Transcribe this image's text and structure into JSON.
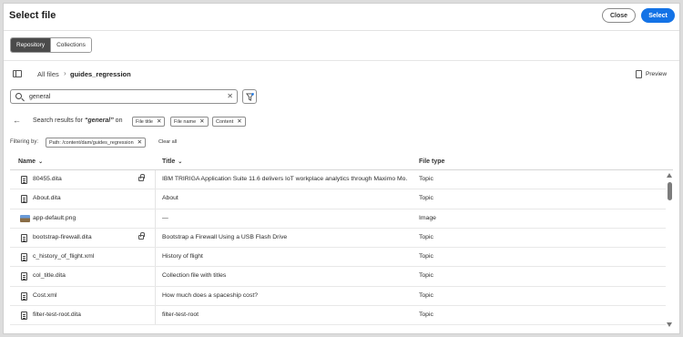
{
  "dialog": {
    "title": "Select file",
    "close_label": "Close",
    "select_label": "Select"
  },
  "tabs": [
    {
      "label": "Repository",
      "active": true
    },
    {
      "label": "Collections",
      "active": false
    }
  ],
  "breadcrumb": {
    "root": "All files",
    "separator": "›",
    "current": "guides_regression"
  },
  "preview_label": "Preview",
  "search": {
    "value": "general",
    "clear_glyph": "✕"
  },
  "results": {
    "prefix": "Search results for",
    "query": "“general”",
    "suffix": "on",
    "chips": [
      "File title",
      "File name",
      "Content"
    ]
  },
  "filtering": {
    "label": "Filtering by:",
    "chip": "Path: /content/dam/guides_regression",
    "clear_all": "Clear all"
  },
  "columns": {
    "name": "Name",
    "title": "Title",
    "type": "File type"
  },
  "rows": [
    {
      "name": "80455.dita",
      "title": "IBM TRIRIGA Application Suite 11.6 delivers IoT workplace analytics through Maximo Mo...",
      "type": "Topic",
      "icon": "file-icon",
      "locked": true
    },
    {
      "name": "About.dita",
      "title": "About",
      "type": "Topic",
      "icon": "file-icon",
      "locked": false
    },
    {
      "name": "app-default.png",
      "title": "—",
      "type": "Image",
      "icon": "image-thumbnail-icon",
      "locked": false
    },
    {
      "name": "bootstrap-firewall.dita",
      "title": "Bootstrap a Firewall Using a USB Flash Drive",
      "type": "Topic",
      "icon": "file-icon",
      "locked": true
    },
    {
      "name": "c_history_of_flight.xml",
      "title": "History of flight",
      "type": "Topic",
      "icon": "file-icon",
      "locked": false
    },
    {
      "name": "col_title.dita",
      "title": "Collection file with titles",
      "type": "Topic",
      "icon": "file-icon",
      "locked": false
    },
    {
      "name": "Cost.xml",
      "title": "How much does a spaceship cost?",
      "type": "Topic",
      "icon": "file-icon",
      "locked": false
    },
    {
      "name": "filter-test-root.dita",
      "title": "filter-test-root",
      "type": "Topic",
      "icon": "file-icon",
      "locked": false
    }
  ],
  "colors": {
    "accent": "#1473e6",
    "active_tab": "#4b4b4b"
  }
}
